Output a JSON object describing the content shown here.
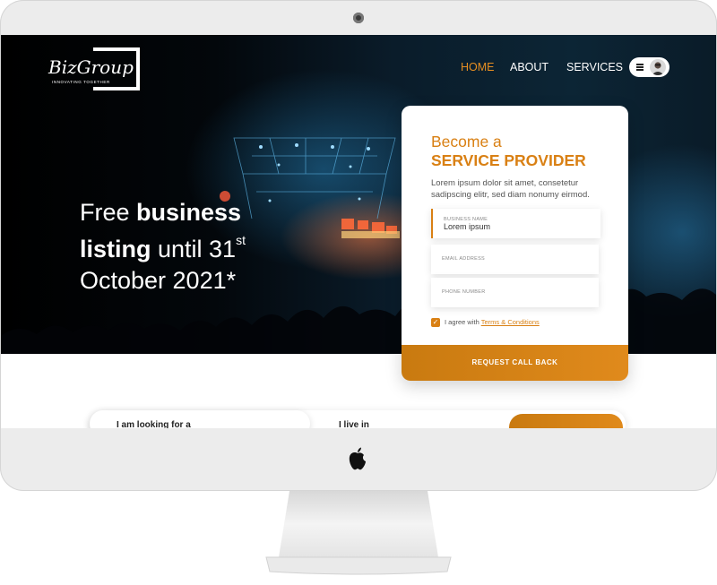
{
  "brand": {
    "name": "BizGroup",
    "tagline": "INNOVATING TOGETHER"
  },
  "nav": {
    "items": [
      {
        "label": "HOME",
        "active": true
      },
      {
        "label": "ABOUT",
        "active": false
      },
      {
        "label": "SERVICES",
        "active": false
      }
    ]
  },
  "hero": {
    "line1_pre": "Free ",
    "line1_bold": "business",
    "line2_bold": "listing",
    "line2_post": " until 31",
    "line2_sup": "st",
    "line3": "October 2021*"
  },
  "form": {
    "title_line1": "Become a",
    "title_line2": "SERVICE PROVIDER",
    "description": "Lorem ipsum dolor sit amet, consetetur sadipscing elitr, sed diam nonumy eirmod.",
    "fields": [
      {
        "label": "BUSINESS NAME",
        "value": "Lorem ipsum"
      },
      {
        "label": "EMAIL ADDRESS",
        "value": ""
      },
      {
        "label": "PHONE NUMBER",
        "value": ""
      }
    ],
    "agree_text": "I agree with ",
    "terms_link": "Terms & Conditions",
    "agree_checked": true,
    "submit_label": "REQUEST CALL BACK"
  },
  "search": {
    "looking_for_label": "I am looking for a",
    "live_in_label": "I live in"
  },
  "colors": {
    "accent": "#d98014",
    "nav_active": "#e58e22",
    "hero_bg": "#03070b",
    "monitor": "#ececec"
  }
}
